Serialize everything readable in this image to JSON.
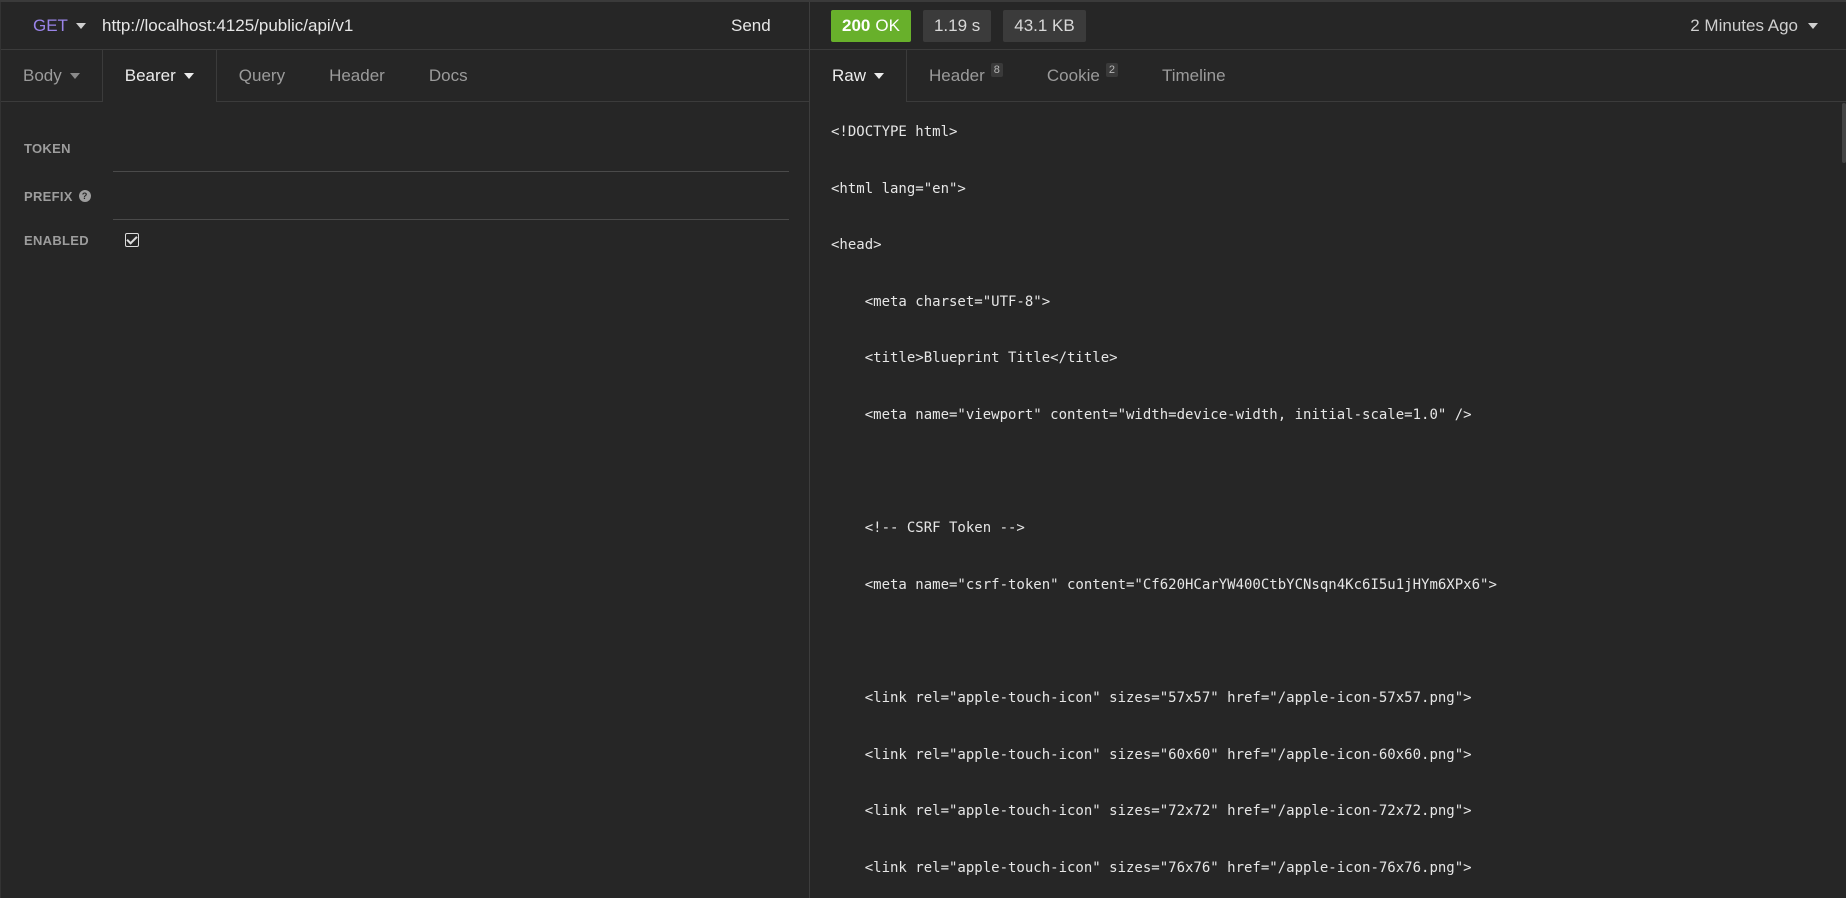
{
  "request": {
    "method": "GET",
    "url": "http://localhost:4125/public/api/v1",
    "send_label": "Send",
    "tabs": [
      {
        "label": "Body"
      },
      {
        "label": "Bearer"
      },
      {
        "label": "Query"
      },
      {
        "label": "Header"
      },
      {
        "label": "Docs"
      }
    ],
    "auth": {
      "token_label": "TOKEN",
      "token_value": "",
      "prefix_label": "PREFIX",
      "prefix_value": "",
      "enabled_label": "ENABLED",
      "enabled": true
    }
  },
  "response": {
    "status_code": "200",
    "status_text": "OK",
    "time": "1.19 s",
    "size": "43.1 KB",
    "age": "2 Minutes Ago",
    "tabs": [
      {
        "label": "Raw"
      },
      {
        "label": "Header",
        "badge": "8"
      },
      {
        "label": "Cookie",
        "badge": "2"
      },
      {
        "label": "Timeline"
      }
    ],
    "lines": [
      "<!DOCTYPE html>",
      "<html lang=\"en\">",
      "<head>",
      "    <meta charset=\"UTF-8\">",
      "    <title>Blueprint Title</title>",
      "    <meta name=\"viewport\" content=\"width=device-width, initial-scale=1.0\" />",
      "",
      "    <!-- CSRF Token -->",
      "    <meta name=\"csrf-token\" content=\"Cf620HCarYW400CtbYCNsqn4Kc6I5u1jHYm6XPx6\">",
      "",
      "    <link rel=\"apple-touch-icon\" sizes=\"57x57\" href=\"/apple-icon-57x57.png\">",
      "    <link rel=\"apple-touch-icon\" sizes=\"60x60\" href=\"/apple-icon-60x60.png\">",
      "    <link rel=\"apple-touch-icon\" sizes=\"72x72\" href=\"/apple-icon-72x72.png\">",
      "    <link rel=\"apple-touch-icon\" sizes=\"76x76\" href=\"/apple-icon-76x76.png\">"
    ]
  },
  "colors": {
    "method": "#9a84e8",
    "status_ok": "#68b02b",
    "background": "#262626"
  }
}
